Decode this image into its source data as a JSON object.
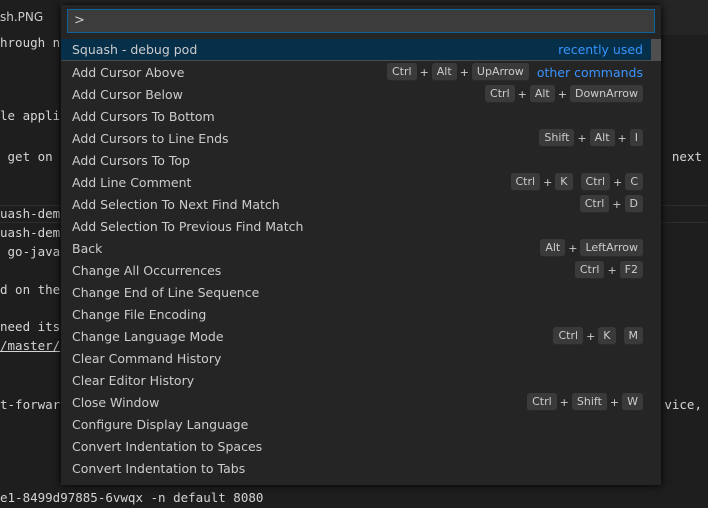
{
  "editor": {
    "tab_label": "sh.PNG",
    "lines": [
      {
        "text": "hrough n",
        "right": ""
      },
      {
        "text": "le appli",
        "right": ""
      },
      {
        "text": " get on",
        "right": "next"
      },
      {
        "text": "uash-dem",
        "right": ""
      },
      {
        "text": "uash-dem",
        "right": ""
      },
      {
        "text": " go-java",
        "right": ""
      },
      {
        "text": "d on the",
        "right": ""
      },
      {
        "text": "need its",
        "right": ""
      },
      {
        "text": "/master/",
        "right": ""
      },
      {
        "text": "t-forwar",
        "right": "vice,"
      },
      {
        "text": "e1-8499d97885-6vwqx -n default 8080",
        "right": ""
      }
    ]
  },
  "palette": {
    "input_value": ">",
    "items": [
      {
        "label": "Squash - debug pod",
        "tag": "recently used",
        "keys": []
      },
      {
        "label": "Add Cursor Above",
        "tag": "other commands",
        "keys": [
          [
            "Ctrl",
            "Alt",
            "UpArrow"
          ]
        ]
      },
      {
        "label": "Add Cursor Below",
        "tag": "",
        "keys": [
          [
            "Ctrl",
            "Alt",
            "DownArrow"
          ]
        ]
      },
      {
        "label": "Add Cursors To Bottom",
        "tag": "",
        "keys": []
      },
      {
        "label": "Add Cursors to Line Ends",
        "tag": "",
        "keys": [
          [
            "Shift",
            "Alt",
            "I"
          ]
        ]
      },
      {
        "label": "Add Cursors To Top",
        "tag": "",
        "keys": []
      },
      {
        "label": "Add Line Comment",
        "tag": "",
        "keys": [
          [
            "Ctrl",
            "K"
          ],
          [
            "Ctrl",
            "C"
          ]
        ]
      },
      {
        "label": "Add Selection To Next Find Match",
        "tag": "",
        "keys": [
          [
            "Ctrl",
            "D"
          ]
        ]
      },
      {
        "label": "Add Selection To Previous Find Match",
        "tag": "",
        "keys": []
      },
      {
        "label": "Back",
        "tag": "",
        "keys": [
          [
            "Alt",
            "LeftArrow"
          ]
        ]
      },
      {
        "label": "Change All Occurrences",
        "tag": "",
        "keys": [
          [
            "Ctrl",
            "F2"
          ]
        ]
      },
      {
        "label": "Change End of Line Sequence",
        "tag": "",
        "keys": []
      },
      {
        "label": "Change File Encoding",
        "tag": "",
        "keys": []
      },
      {
        "label": "Change Language Mode",
        "tag": "",
        "keys": [
          [
            "Ctrl",
            "K"
          ],
          [
            "M"
          ]
        ]
      },
      {
        "label": "Clear Command History",
        "tag": "",
        "keys": []
      },
      {
        "label": "Clear Editor History",
        "tag": "",
        "keys": []
      },
      {
        "label": "Close Window",
        "tag": "",
        "keys": [
          [
            "Ctrl",
            "Shift",
            "W"
          ]
        ]
      },
      {
        "label": "Configure Display Language",
        "tag": "",
        "keys": []
      },
      {
        "label": "Convert Indentation to Spaces",
        "tag": "",
        "keys": []
      },
      {
        "label": "Convert Indentation to Tabs",
        "tag": "",
        "keys": []
      }
    ]
  },
  "colors": {
    "accent": "#3794ff",
    "selection": "#062f4a",
    "focus_border": "#0e639c"
  }
}
